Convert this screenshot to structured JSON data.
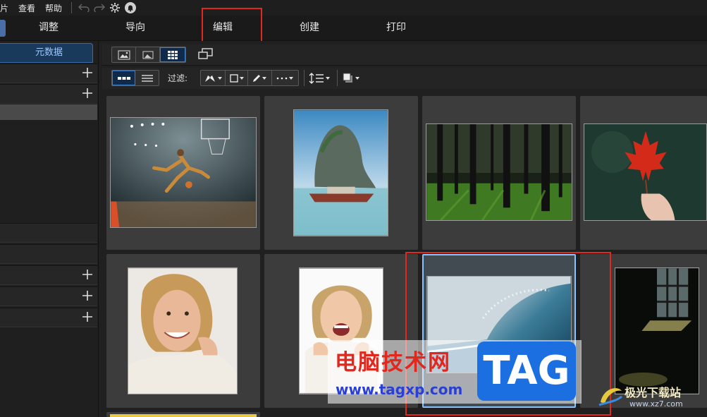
{
  "menubar": {
    "items": [
      "照片",
      "查看",
      "帮助"
    ]
  },
  "tabs": {
    "items": [
      "调整",
      "导向",
      "编辑",
      "创建",
      "打印"
    ],
    "highlighted": "编辑"
  },
  "left_panel": {
    "tab_label": "元数据"
  },
  "filter_toolbar": {
    "filter_label": "过滤:"
  },
  "thumbnails": [
    {
      "subject": "basketball player dunking in arena"
    },
    {
      "subject": "rock island with longtail boat"
    },
    {
      "subject": "sunlit forest"
    },
    {
      "subject": "red maple leaf held by hand"
    },
    {
      "subject": "smiling woman in white sweater"
    },
    {
      "subject": "laughing young woman"
    },
    {
      "subject": "ocean wave"
    },
    {
      "subject": "dark room with window light"
    }
  ],
  "watermark": {
    "site_name": "电脑技术网",
    "url": "www.tagxp.com",
    "badge": "TAG",
    "corner_name": "极光下载站",
    "corner_url": "www.xz7.com"
  },
  "colors": {
    "highlight_red": "#e0281e",
    "selection_blue": "#86c3ff",
    "accent_blue": "#3c7cc8"
  }
}
